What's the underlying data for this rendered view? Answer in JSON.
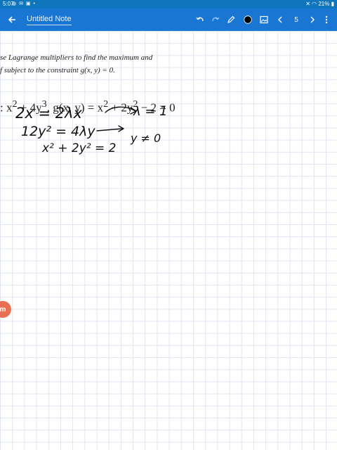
{
  "status_bar": {
    "time": "5:07",
    "battery": "21%",
    "icons": [
      "messenger-icon",
      "mail-icon",
      "email-icon",
      "dot-icon",
      "mute-icon",
      "wifi-icon",
      "battery-icon"
    ]
  },
  "app_bar": {
    "note_title": "Untitled Note",
    "page_number": "5",
    "pen_color": "#000000",
    "bar_color": "#1976d2"
  },
  "problem": {
    "line1": "se Lagrange multipliers to find the maximum and",
    "line2": "f subject to the constraint g(x, y) = 0.",
    "equation_prefix": ": x",
    "equation_mid": " + 4y",
    "equation_tail": ", g(x, y) = x",
    "equation_end": " + 2y",
    "equation_final": " − 2 = 0",
    "exp2": "2",
    "exp3": "3"
  },
  "handwriting": {
    "line1": "2x = 2λx",
    "line1_result": "λ = 1",
    "line2": "12y² = 4λy",
    "line2_result": "y ≠ 0",
    "line3": "x² + 2y² = 2"
  },
  "badge": {
    "label": "m"
  }
}
